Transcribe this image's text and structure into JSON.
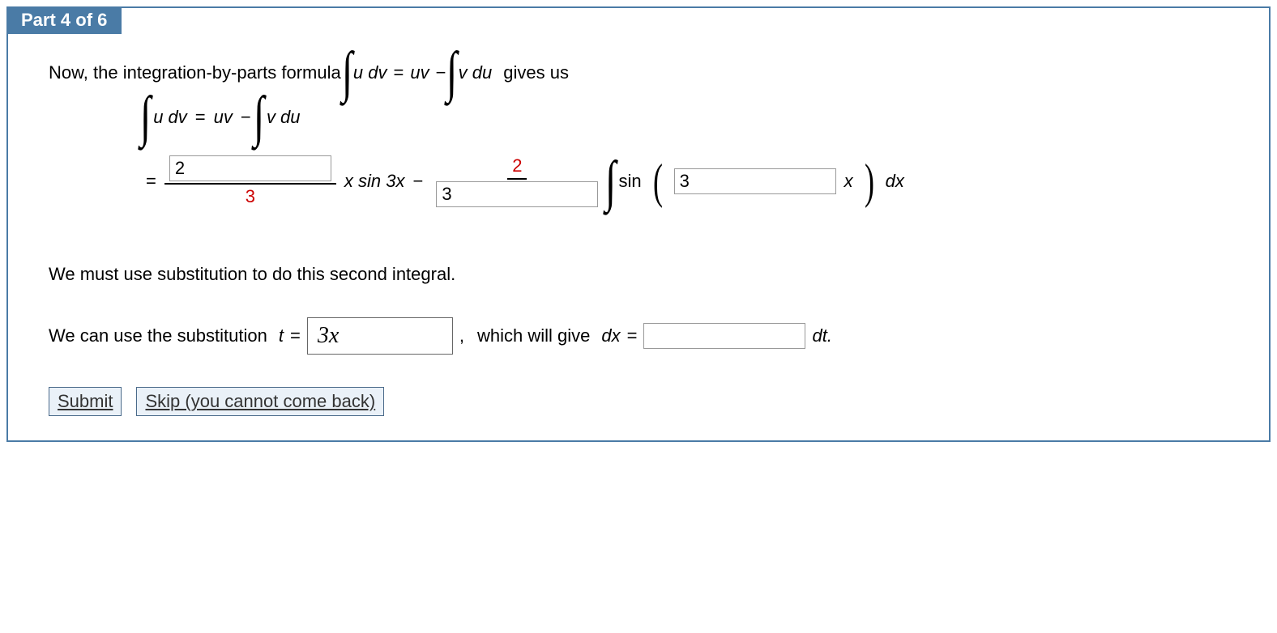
{
  "header": {
    "part_label": "Part 4 of 6"
  },
  "intro": {
    "text_before": "Now, the integration-by-parts formula",
    "formula_udv": "u dv",
    "formula_eq": "=",
    "formula_uv": "uv",
    "formula_minus": "−",
    "formula_vdu": "v du",
    "text_after": "gives us"
  },
  "formula_line": {
    "udv": "u dv",
    "eq": "=",
    "uv": "uv",
    "minus": "−",
    "vdu": "v du"
  },
  "equation": {
    "eq": "=",
    "input1_value": "2",
    "denom1": "3",
    "xsintx": "x sin 3x",
    "minus": "−",
    "num2": "2",
    "input2_value": "3",
    "sin": "sin",
    "input3_value": "3",
    "x": "x",
    "dx": "dx"
  },
  "substitution": {
    "text1": "We must use substitution to do this second integral.",
    "text2_before": "We can use the substitution",
    "t_eq": "t",
    "eq": "=",
    "box_value": "3x",
    "comma": ",",
    "text2_mid": "which will give",
    "dx": "dx",
    "eq2": "=",
    "input_value": "",
    "dt": "dt."
  },
  "buttons": {
    "submit": "Submit",
    "skip": "Skip (you cannot come back)"
  }
}
